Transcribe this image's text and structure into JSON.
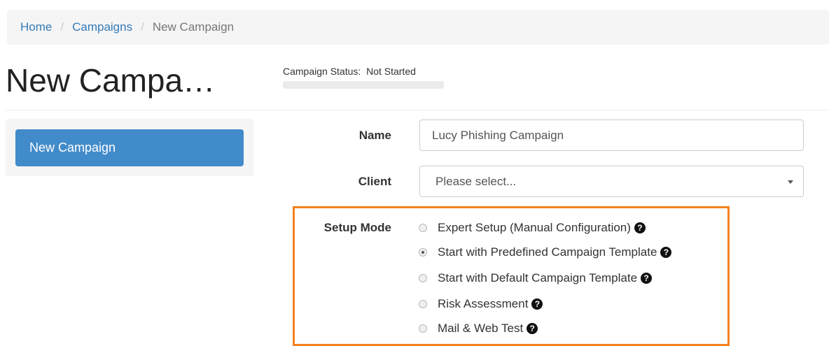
{
  "breadcrumb": {
    "items": [
      {
        "label": "Home"
      },
      {
        "label": "Campaigns"
      }
    ],
    "separator": "/",
    "current": "New Campaign"
  },
  "page": {
    "title": "New Campa…"
  },
  "status": {
    "label": "Campaign Status:",
    "value": "Not Started",
    "progress": 0
  },
  "sidebar": {
    "button_label": "New Campaign"
  },
  "form": {
    "name": {
      "label": "Name",
      "value": "Lucy Phishing Campaign"
    },
    "client": {
      "label": "Client",
      "selected": "Please select..."
    },
    "setup_mode": {
      "label": "Setup Mode",
      "options": [
        {
          "label": "Expert Setup (Manual Configuration)",
          "checked": false
        },
        {
          "label": "Start with Predefined Campaign Template",
          "checked": true
        },
        {
          "label": "Start with Default Campaign Template",
          "checked": false
        },
        {
          "label": "Risk Assessment",
          "checked": false
        },
        {
          "label": "Mail & Web Test",
          "checked": false
        }
      ]
    }
  },
  "colors": {
    "link": "#337ab7",
    "primary_button": "#428bca",
    "highlight_border": "#f58220"
  },
  "icons": {
    "help": "question-circle-icon",
    "select_caret": "caret-down-icon"
  }
}
